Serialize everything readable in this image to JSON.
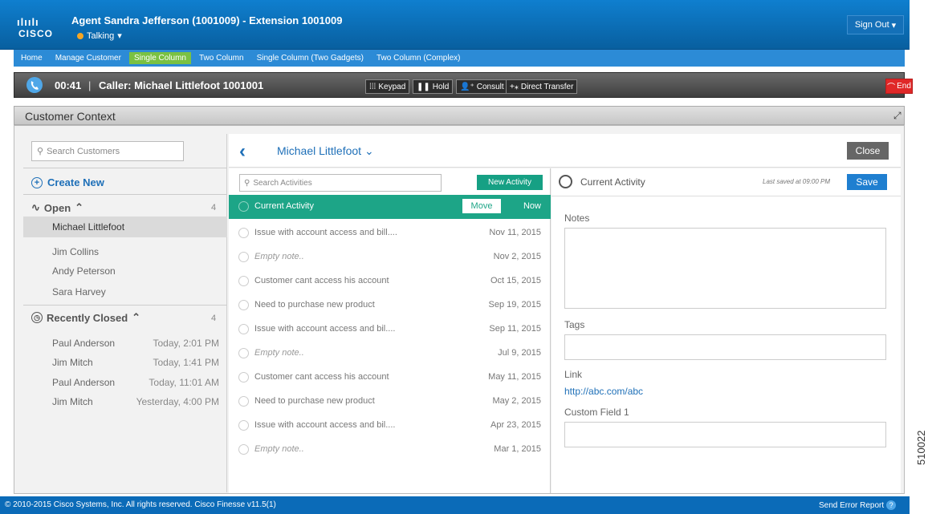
{
  "header": {
    "logo_bars": "ılıılı",
    "logo_text": "CISCO",
    "agent_title": "Agent Sandra Jefferson (1001009) - Extension 1001009",
    "status": "Talking",
    "status_color": "#f6a623",
    "sign_out": "Sign Out"
  },
  "nav": {
    "items": [
      "Home",
      "Manage Customer",
      "Single Column",
      "Two Column",
      "Single Column (Two Gadgets)",
      "Two Column (Complex)"
    ],
    "active": "Single Column"
  },
  "call": {
    "timer": "00:41",
    "separator": "|",
    "caller": "Caller: Michael Littlefoot  1001001",
    "keypad": "Keypad",
    "hold": "Hold",
    "consult": "Consult",
    "direct_transfer": "Direct Transfer",
    "end": "End",
    "end_color": "#e02828"
  },
  "context": {
    "title": "Customer Context"
  },
  "sidebar": {
    "search_placeholder": "Search Customers",
    "create_new": "Create New",
    "open_label": "Open",
    "open_count": "4",
    "open_items": [
      "Michael Littlefoot",
      "Jim Collins",
      "Andy Peterson",
      "Sara Harvey"
    ],
    "closed_label": "Recently Closed",
    "closed_count": "4",
    "closed_items": [
      {
        "name": "Paul Anderson",
        "time": "Today, 2:01 PM"
      },
      {
        "name": "Jim Mitch",
        "time": "Today, 1:41 PM"
      },
      {
        "name": "Paul Anderson",
        "time": "Today, 11:01 AM"
      },
      {
        "name": "Jim Mitch",
        "time": "Yesterday, 4:00 PM"
      }
    ]
  },
  "topbar": {
    "customer_name": "Michael Littlefoot",
    "close": "Close"
  },
  "activities": {
    "search_placeholder": "Search Activities",
    "new_activity": "New Activity",
    "move": "Move",
    "items": [
      {
        "label": "Current Activity",
        "date": "Now",
        "current": true,
        "italic": false
      },
      {
        "label": "Issue with account access and bill....",
        "date": "Nov 11, 2015",
        "current": false,
        "italic": false
      },
      {
        "label": "Empty note..",
        "date": "Nov 2, 2015",
        "current": false,
        "italic": true
      },
      {
        "label": "Customer cant access his account",
        "date": "Oct 15, 2015",
        "current": false,
        "italic": false
      },
      {
        "label": "Need to purchase new product",
        "date": "Sep 19, 2015",
        "current": false,
        "italic": false
      },
      {
        "label": "Issue with account access and bil....",
        "date": "Sep 11, 2015",
        "current": false,
        "italic": false
      },
      {
        "label": "Empty note..",
        "date": "Jul 9, 2015",
        "current": false,
        "italic": true
      },
      {
        "label": "Customer cant access his account",
        "date": "May 11, 2015",
        "current": false,
        "italic": false
      },
      {
        "label": "Need to purchase new product",
        "date": "May 2, 2015",
        "current": false,
        "italic": false
      },
      {
        "label": "Issue with account access and bil....",
        "date": "Apr 23, 2015",
        "current": false,
        "italic": false
      },
      {
        "label": "Empty note..",
        "date": "Mar 1, 2015",
        "current": false,
        "italic": true
      }
    ]
  },
  "detail": {
    "title": "Current Activity",
    "last_saved": "Last saved at 09:00 PM",
    "save": "Save",
    "notes_label": "Notes",
    "tags_label": "Tags",
    "link_label": "Link",
    "link_value": "http://abc.com/abc",
    "custom_field_label": "Custom Field 1"
  },
  "footer": {
    "copyright": "© 2010-2015 Cisco Systems, Inc. All rights reserved. Cisco Finesse v11.5(1)",
    "send_error": "Send Error Report",
    "help": "?"
  },
  "figure_id": "510022"
}
